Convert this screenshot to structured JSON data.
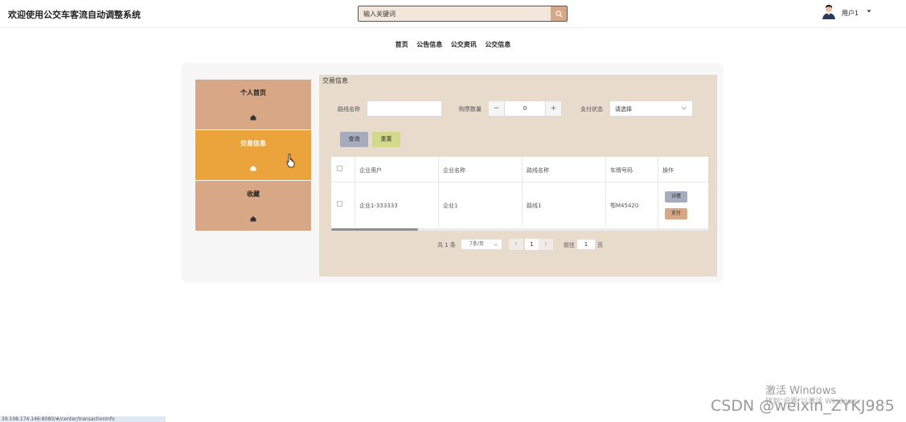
{
  "header": {
    "title": "欢迎使用公交车客流自动调整系统",
    "search_placeholder": "输入关键词",
    "user_name": "用户1",
    "icons": {
      "search": "search-icon",
      "avatar": "avatar",
      "caret": "caret-down-icon"
    }
  },
  "nav": {
    "items": [
      "首页",
      "公告信息",
      "公交资讯",
      "公交信息"
    ]
  },
  "sidebar": {
    "items": [
      {
        "label": "个人首页",
        "icon": "home-icon",
        "active": false
      },
      {
        "label": "交易信息",
        "icon": "home-icon",
        "active": true
      },
      {
        "label": "收藏",
        "icon": "home-icon",
        "active": false
      }
    ]
  },
  "main": {
    "title": "交易信息",
    "filters": {
      "route_label": "路线名称",
      "route_value": "",
      "tickets_label": "购票数量",
      "tickets_value": "0",
      "pay_label": "支付状态",
      "pay_placeholder": "请选择"
    },
    "buttons": {
      "query": "查询",
      "reset": "重置"
    },
    "table": {
      "headers": [
        "企业用户",
        "企业名称",
        "路线名称",
        "车牌号码",
        "操作"
      ],
      "rows": [
        {
          "user": "企业1-333333",
          "company": "企业1",
          "route": "路线1",
          "plate": "鄂M45420",
          "detail": "详情",
          "pay": "支付"
        }
      ]
    },
    "pagination": {
      "total": "共 1 条",
      "page_size": "7条/页",
      "current": "1",
      "goto_prefix": "前往",
      "goto_value": "1",
      "goto_suffix": "页"
    }
  },
  "watermarks": {
    "windows_line1": "激活 Windows",
    "windows_line2": "转到\"设置\"以激活 Windows。",
    "csdn": "CSDN @weixin_ZYKJ985"
  },
  "status_bar": {
    "url": "39.108.174.146:8080/#/center/transactionInfo"
  },
  "colors": {
    "sidebar_item": "#d8a786",
    "sidebar_active": "#eba43b",
    "panel_bg": "#e8dbcc",
    "query_button": "#a6abbd",
    "reset_button": "#d3d98a",
    "detail_button": "#a6abbd",
    "pay_button": "#d8a786"
  }
}
